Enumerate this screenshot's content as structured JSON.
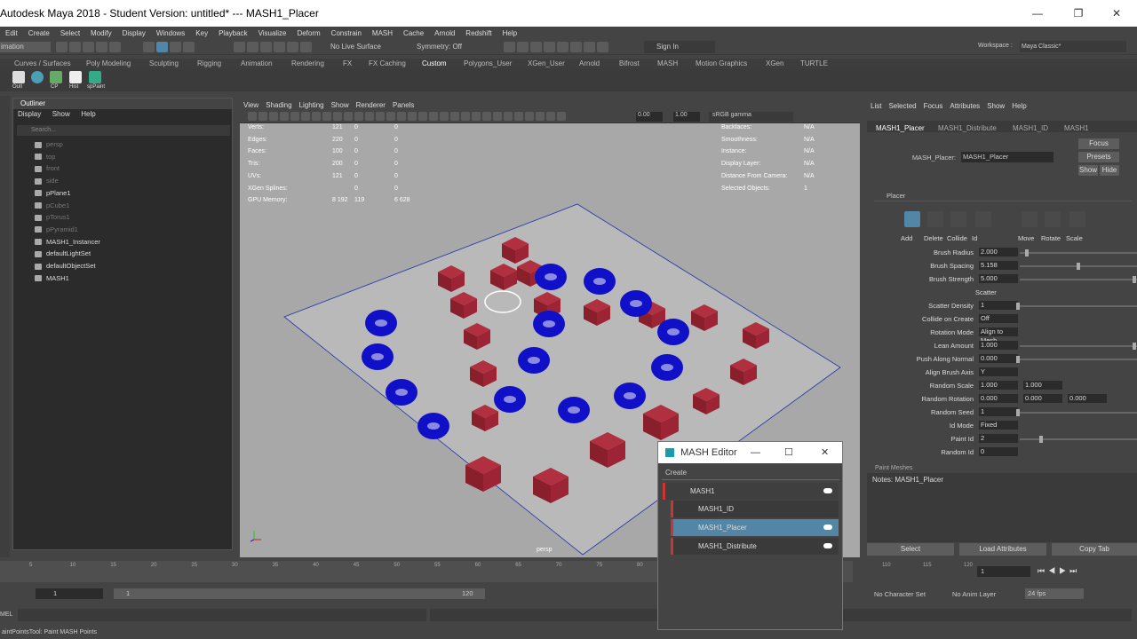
{
  "window": {
    "title": "Autodesk Maya 2018 - Student Version: untitled*   ---   MASH1_Placer"
  },
  "menubar": [
    "Edit",
    "Create",
    "Select",
    "Modify",
    "Display",
    "Windows",
    "Key",
    "Playback",
    "Visualize",
    "Deform",
    "Constrain",
    "MASH",
    "Cache",
    "Arnold",
    "Redshift",
    "Help"
  ],
  "workspace": {
    "label": "Workspace :",
    "value": "Maya Classic*"
  },
  "statusline": {
    "mode": "imation",
    "live_surface": "No Live Surface",
    "symmetry": "Symmetry: Off",
    "sign_in": "Sign In"
  },
  "shelf_tabs": [
    "Curves / Surfaces",
    "Poly Modeling",
    "Sculpting",
    "Rigging",
    "Animation",
    "Rendering",
    "FX",
    "FX Caching",
    "Custom",
    "Polygons_User",
    "XGen_User",
    "Arnold",
    "Bifrost",
    "MASH",
    "Motion Graphics",
    "XGen",
    "TURTLE"
  ],
  "shelf_icons": [
    "Outl",
    "CP",
    "Hist",
    "spPaint"
  ],
  "outliner": {
    "title": "Outliner",
    "menu": [
      "Display",
      "Show",
      "Help"
    ],
    "search_placeholder": "Search...",
    "items": [
      "persp",
      "top",
      "front",
      "side",
      "pPlane1",
      "pCube1",
      "pTorus1",
      "pPyramid1",
      "MASH1_Instancer",
      "defaultLightSet",
      "defaultObjectSet",
      "MASH1"
    ]
  },
  "viewport": {
    "menu": [
      "View",
      "Shading",
      "Lighting",
      "Show",
      "Renderer",
      "Panels"
    ],
    "exposure": "0.00",
    "gamma": "1.00",
    "colorspace": "sRGB gamma",
    "camera_label": "persp",
    "hud_left": [
      [
        "Verts:",
        "121",
        "0",
        "0"
      ],
      [
        "Edges:",
        "220",
        "0",
        "0"
      ],
      [
        "Faces:",
        "100",
        "0",
        "0"
      ],
      [
        "Tris:",
        "200",
        "0",
        "0"
      ],
      [
        "UVs:",
        "121",
        "0",
        "0"
      ],
      [
        "XGen Splines:",
        "",
        "0",
        "0"
      ],
      [
        "GPU Memory:",
        "8 192",
        "119",
        "6 628"
      ]
    ],
    "hud_right": [
      [
        "Backfaces:",
        "N/A"
      ],
      [
        "Smoothness:",
        "N/A"
      ],
      [
        "Instance:",
        "N/A"
      ],
      [
        "Display Layer:",
        "N/A"
      ],
      [
        "Distance From Camera:",
        "N/A"
      ],
      [
        "Selected Objects:",
        "1"
      ]
    ]
  },
  "attr_editor": {
    "menu": [
      "List",
      "Selected",
      "Focus",
      "Attributes",
      "Show",
      "Help"
    ],
    "tabs": [
      "MASH1_Placer",
      "MASH1_Distribute",
      "MASH1_ID",
      "MASH1"
    ],
    "node_label": "MASH_Placer:",
    "node_value": "MASH1_Placer",
    "focus": "Focus",
    "presets": "Presets",
    "show": "Show",
    "hide": "Hide",
    "section": "Placer",
    "tools": [
      "Add",
      "Delete",
      "Collide",
      "Id",
      "Move",
      "Rotate",
      "Scale"
    ],
    "attrs": [
      [
        "Brush Radius",
        "2.000"
      ],
      [
        "Brush Spacing",
        "5.158"
      ],
      [
        "Brush Strength",
        "5.000"
      ],
      [
        "",
        "Scatter"
      ],
      [
        "Scatter Density",
        "1"
      ],
      [
        "Collide on Create",
        "Off"
      ],
      [
        "Rotation Mode",
        "Align to Mesh"
      ],
      [
        "Lean Amount",
        "1.000"
      ],
      [
        "Push Along Normal",
        "0.000"
      ],
      [
        "Align Brush Axis",
        "Y"
      ],
      [
        "Random Scale",
        "1.000"
      ],
      [
        "Random Rotation",
        "0.000"
      ],
      [
        "Random Seed",
        "1"
      ],
      [
        "Id Mode",
        "Fixed"
      ],
      [
        "Paint Id",
        "2"
      ],
      [
        "Random Id",
        "0"
      ]
    ],
    "random_scale_2": "1.000",
    "random_rot_2": "0.000",
    "random_rot_3": "0.000",
    "random_id_2": "0",
    "paint_meshes": "Paint Meshes",
    "notes": "Notes:  MASH1_Placer",
    "buttons": [
      "Select",
      "Load Attributes",
      "Copy Tab"
    ]
  },
  "timeline": {
    "ticks": [
      "5",
      "10",
      "15",
      "20",
      "25",
      "30",
      "35",
      "40",
      "45",
      "50",
      "55",
      "60",
      "65",
      "70",
      "75",
      "80"
    ],
    "right_ticks": [
      "110",
      "115",
      "120"
    ],
    "current": "1"
  },
  "range": {
    "start": "1",
    "inner_start": "1",
    "inner_end": "120",
    "no_char": "No Character Set",
    "no_anim": "No Anim Layer",
    "fps": "24 fps"
  },
  "cmd": {
    "label": "MEL"
  },
  "help_line": "aintPointsTool: Paint MASH Points",
  "mash_editor": {
    "title": "MASH Editor",
    "create": "Create",
    "rows": [
      "MASH1",
      "MASH1_ID",
      "MASH1_Placer",
      "MASH1_Distribute"
    ]
  }
}
